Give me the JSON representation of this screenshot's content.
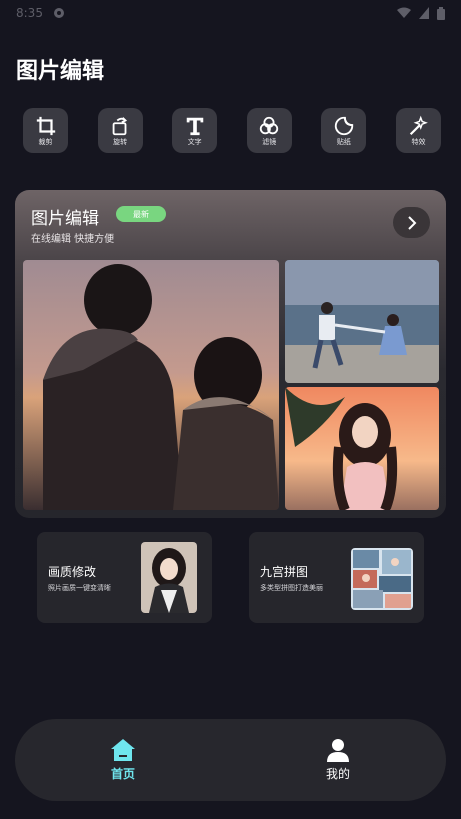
{
  "status_bar": {
    "time": "8:35"
  },
  "header": {
    "title": "图片编辑"
  },
  "tools": [
    {
      "label": "裁剪",
      "icon": "crop-icon"
    },
    {
      "label": "旋转",
      "icon": "rotate-icon"
    },
    {
      "label": "文字",
      "icon": "text-icon"
    },
    {
      "label": "滤镜",
      "icon": "filter-icon"
    },
    {
      "label": "贴纸",
      "icon": "sticker-icon"
    },
    {
      "label": "特效",
      "icon": "magic-wand-icon"
    }
  ],
  "banner": {
    "title": "图片编辑",
    "badge": "最新",
    "subtitle": "在线编辑 快捷方便",
    "arrow_icon": "chevron-right-icon"
  },
  "features": [
    {
      "title": "画质修改",
      "desc": "照片画质一键变清晰"
    },
    {
      "title": "九宫拼图",
      "desc": "多类型拼图打造美丽"
    }
  ],
  "tabbar": {
    "home_label": "首页",
    "mine_label": "我的",
    "active_color": "#6fe6ee"
  },
  "colors": {
    "background": "#15151f",
    "badge": "#79d680",
    "tile": "#3a3a42"
  }
}
